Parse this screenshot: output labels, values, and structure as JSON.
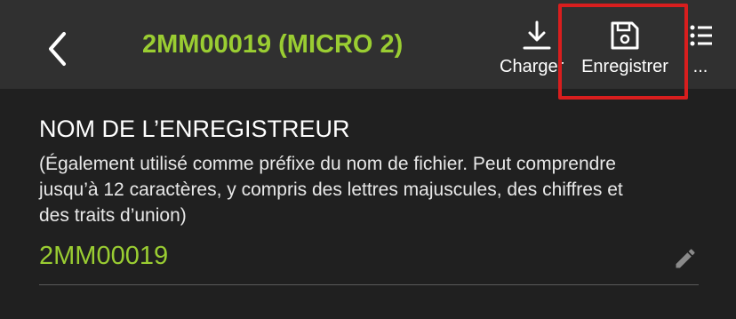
{
  "header": {
    "title": "2MM00019 (MICRO 2)",
    "back_icon": "chevron-left-icon",
    "actions": [
      {
        "label": "Charger",
        "icon": "download-icon"
      },
      {
        "label": "Enregistrer",
        "icon": "floppy-disk-icon"
      },
      {
        "label": "...",
        "icon": "menu-icon"
      }
    ]
  },
  "section": {
    "title": "NOM DE L’ENREGISTREUR",
    "description": "(Également utilisé comme préfixe du nom de fichier.  Peut comprendre jusqu’à 12 caractères, y compris des lettres majuscules, des chiffres et des traits d’union)",
    "value": "2MM00019",
    "edit_icon": "pencil-icon"
  },
  "colors": {
    "accent": "#9acd32",
    "background": "#202020",
    "header_background": "#303030",
    "highlight": "#d81e1e"
  }
}
